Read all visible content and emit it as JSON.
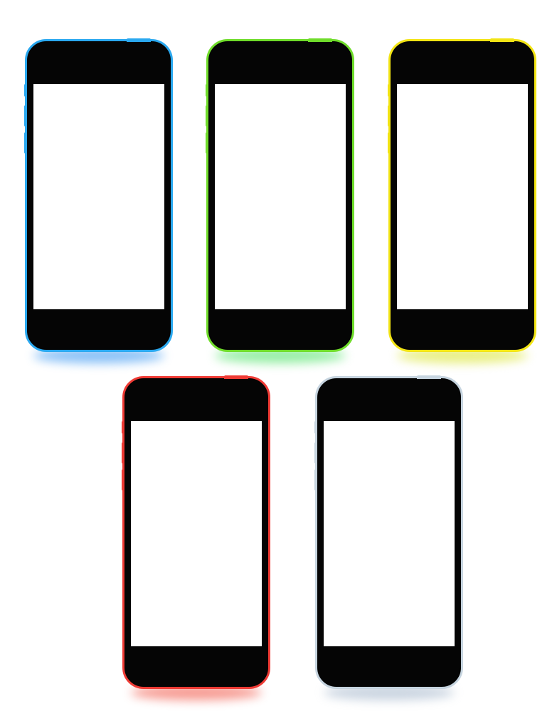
{
  "phones": [
    {
      "id": "blue",
      "accent": "#2aa8ef",
      "shadow": "#2a8ef0"
    },
    {
      "id": "green",
      "accent": "#6fdc2a",
      "shadow": "#3fe05a"
    },
    {
      "id": "yellow",
      "accent": "#f2e414",
      "shadow": "#d6e21c"
    },
    {
      "id": "red",
      "accent": "#ee3a34",
      "shadow": "#f04a3a"
    },
    {
      "id": "white",
      "accent": "#c6d4df",
      "shadow": "#9fb2c8"
    }
  ]
}
